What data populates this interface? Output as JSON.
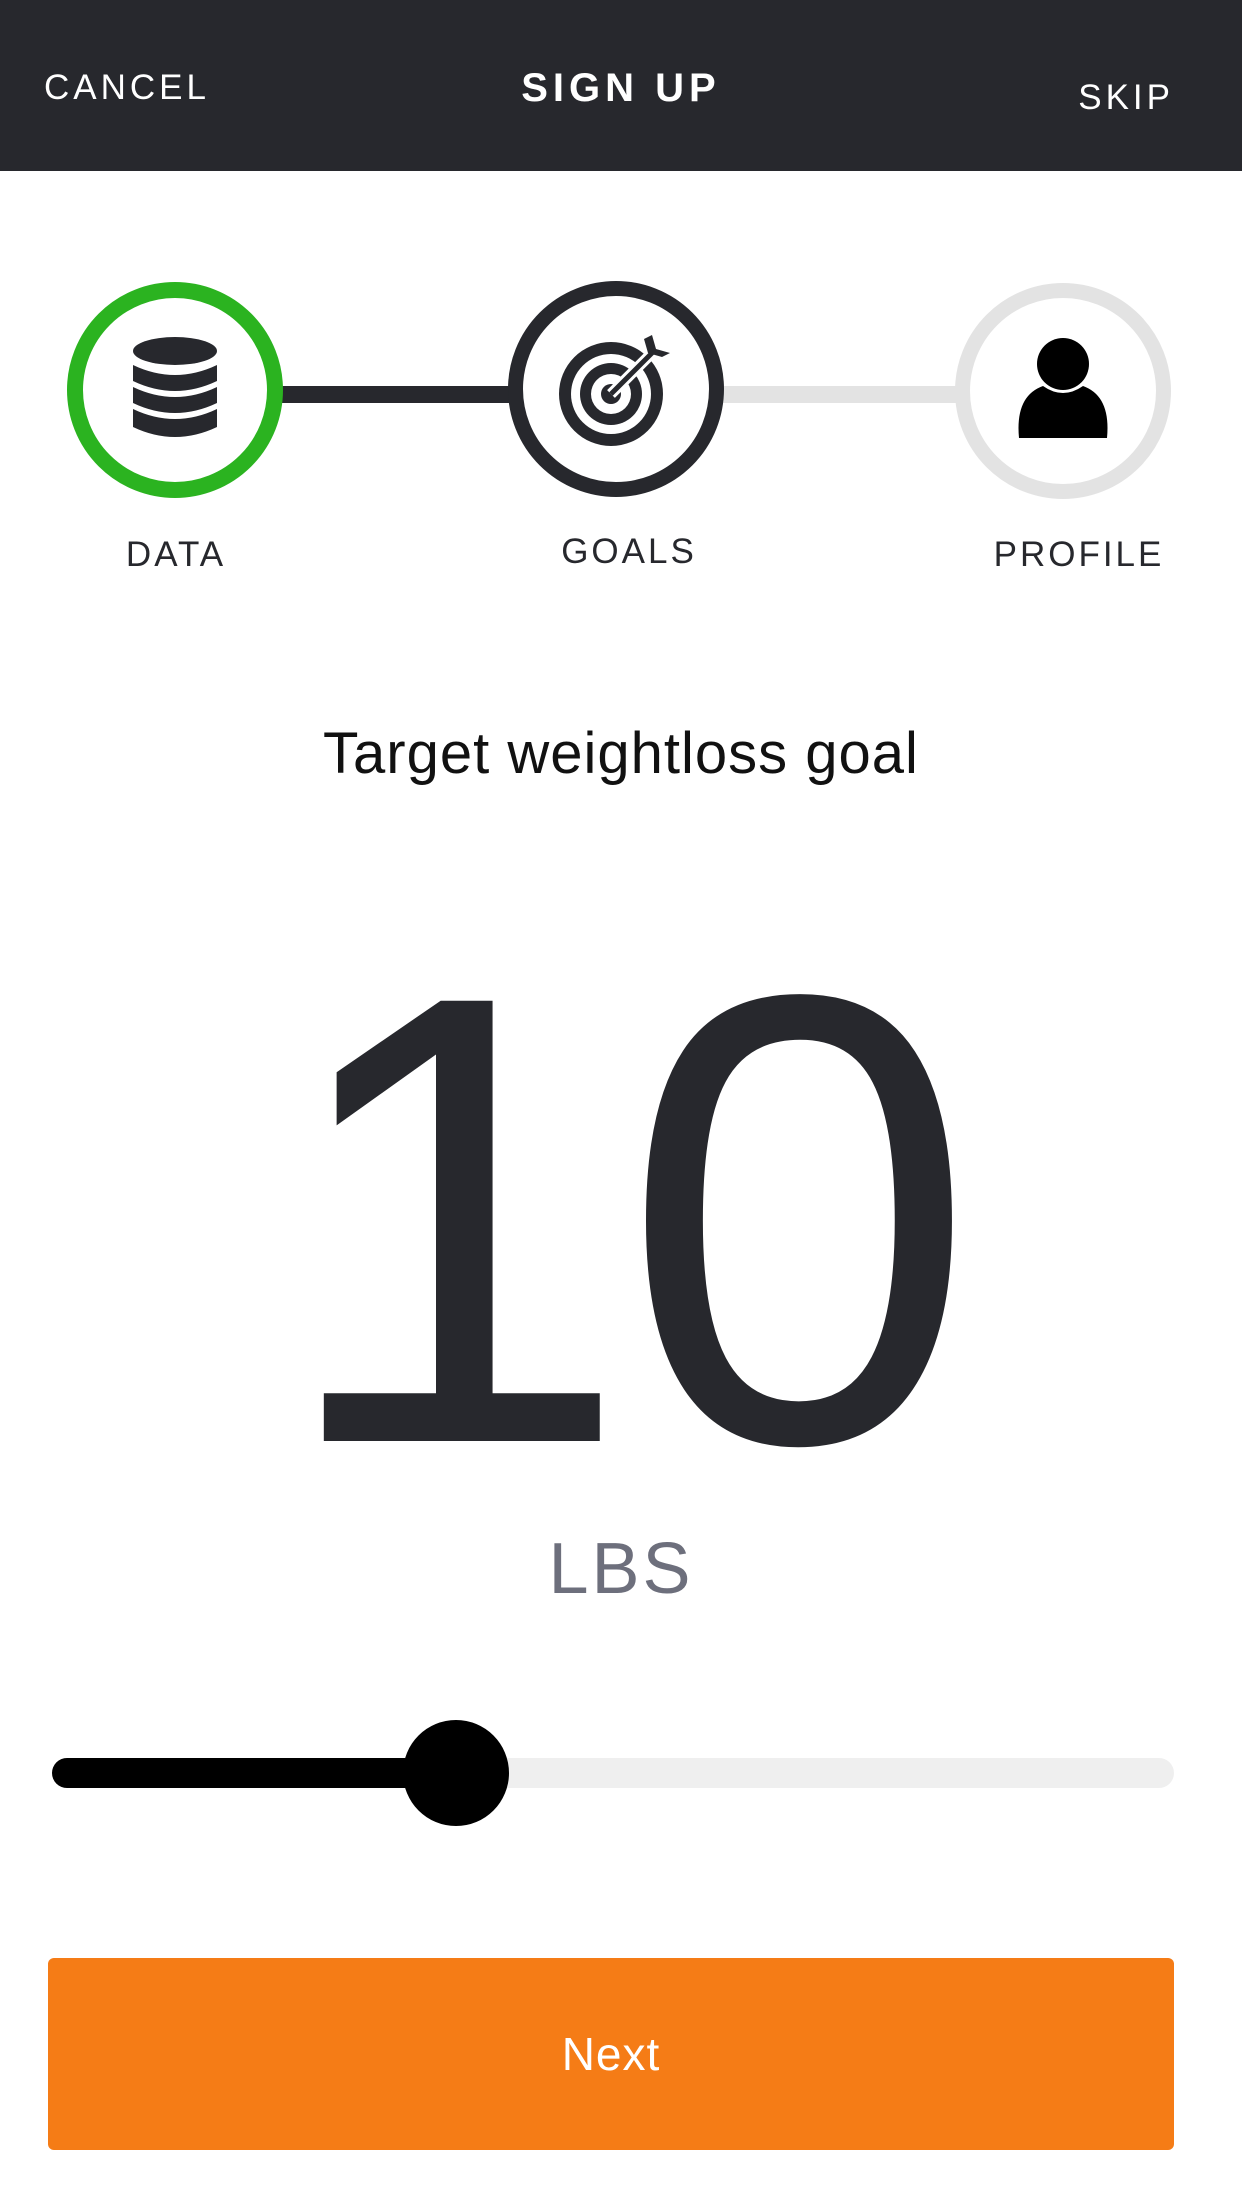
{
  "header": {
    "cancel_label": "CANCEL",
    "title": "SIGN UP",
    "skip_label": "SKIP"
  },
  "steps": [
    {
      "label": "DATA",
      "icon": "database-icon",
      "status": "complete",
      "color": "#2bb320"
    },
    {
      "label": "GOALS",
      "icon": "target-icon",
      "status": "current",
      "color": "#27282d"
    },
    {
      "label": "PROFILE",
      "icon": "user-icon",
      "status": "upcoming",
      "color": "#e3e3e3"
    }
  ],
  "goal": {
    "title": "Target weightloss goal",
    "value": "10",
    "unit": "LBS"
  },
  "slider": {
    "fraction": 0.36
  },
  "next_button": {
    "label": "Next",
    "color": "#f57c16"
  },
  "colors": {
    "header_bg": "#27282d",
    "complete": "#2bb320",
    "accent": "#f57c16"
  }
}
